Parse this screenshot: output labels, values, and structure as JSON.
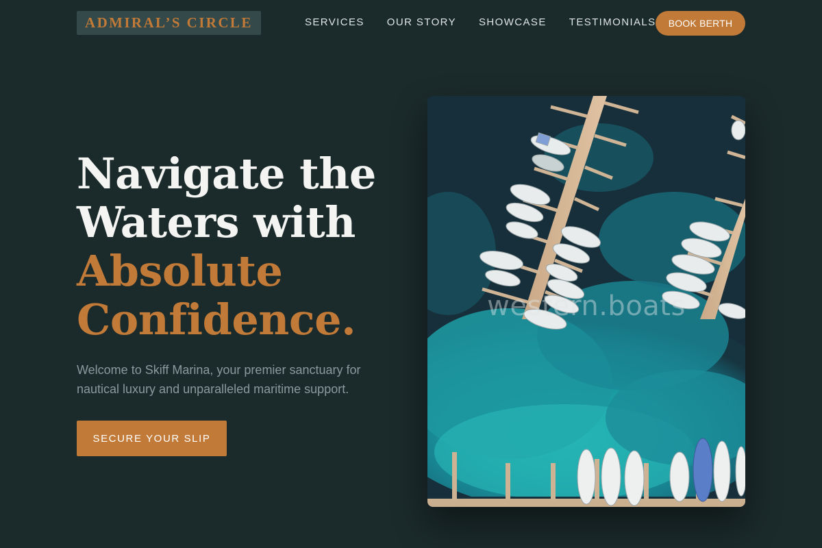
{
  "brand": {
    "name": "ADMIRAL’S CIRCLE"
  },
  "nav": {
    "items": [
      {
        "label": "SERVICES"
      },
      {
        "label": "OUR STORY"
      },
      {
        "label": "SHOWCASE"
      },
      {
        "label": "TESTIMONIALS"
      }
    ],
    "cta_label": "BOOK BERTH"
  },
  "hero": {
    "headline_lines": [
      "Navigate the",
      "Waters with"
    ],
    "headline_accent_lines": [
      "Absolute",
      "Confidence."
    ],
    "intro": "Welcome to Skiff Marina, your premier sanctuary for nautical luxury and unparalleled maritime support.",
    "cta_label": "SECURE YOUR SLIP",
    "image": {
      "subject": "aerial-marina-photo",
      "watermark": "western.boats"
    }
  },
  "colors": {
    "background": "#1b2a2b",
    "accent": "#c17a37",
    "logo_bg": "#34494a",
    "headline": "#f4f5f3",
    "body_text": "#8b9a9c",
    "water_deep": "#16313d",
    "water_shallow": "#1ea2a6"
  }
}
